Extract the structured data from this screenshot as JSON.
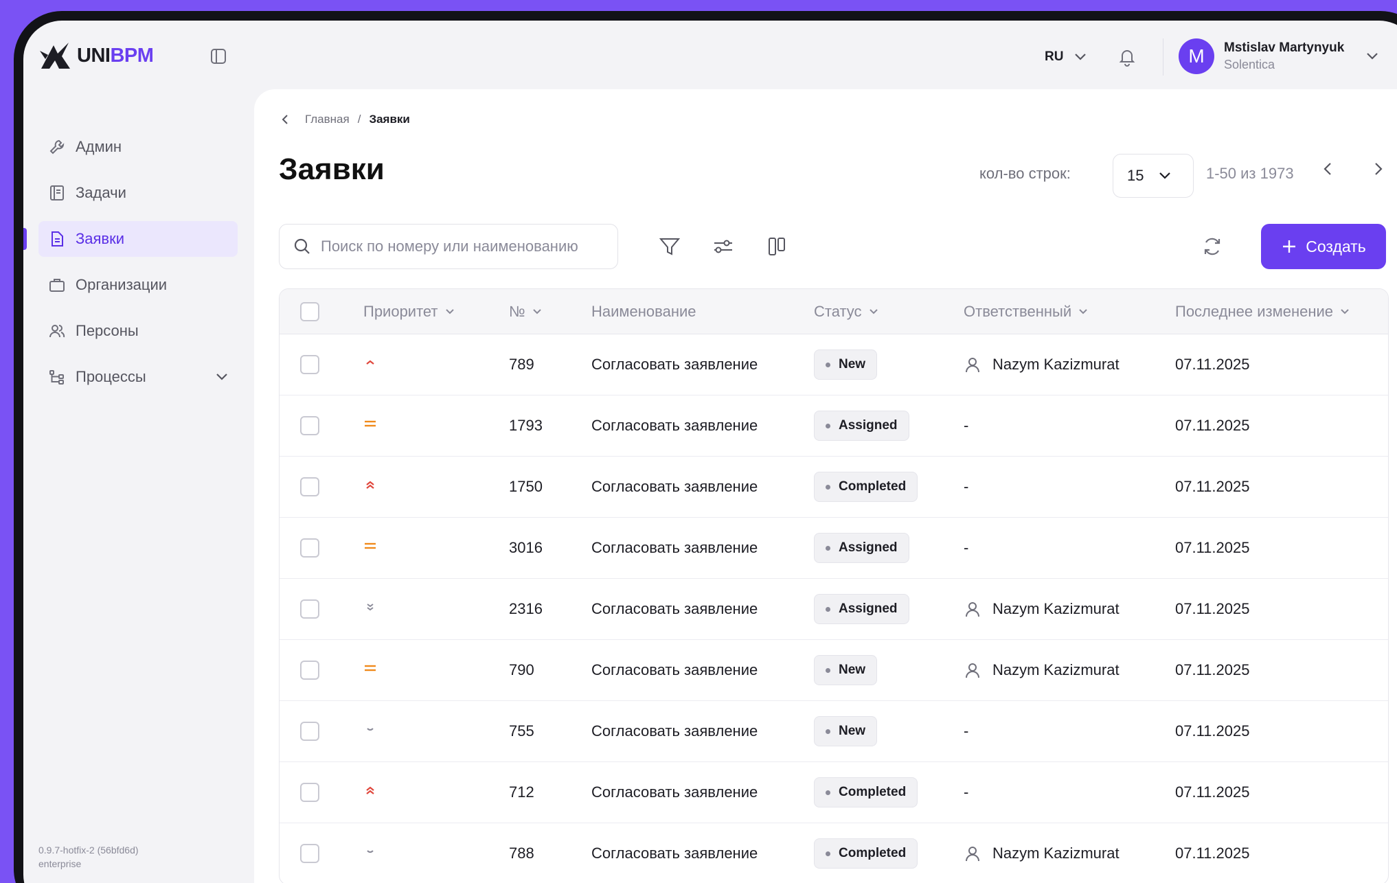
{
  "brand": {
    "logo_dark": "UNI",
    "logo_accent": "BPM"
  },
  "header": {
    "lang": "RU",
    "user_initial": "M",
    "user_name": "Mstislav Martynyuk",
    "user_org": "Solentica"
  },
  "sidebar": {
    "items": [
      {
        "label": "Админ",
        "icon": "wrench-icon"
      },
      {
        "label": "Задачи",
        "icon": "tasks-icon"
      },
      {
        "label": "Заявки",
        "icon": "document-icon",
        "active": true
      },
      {
        "label": "Организации",
        "icon": "briefcase-icon"
      },
      {
        "label": "Персоны",
        "icon": "users-icon"
      },
      {
        "label": "Процессы",
        "icon": "process-icon"
      }
    ],
    "version_line1": "0.9.7-hotfix-2 (56bfd6d)",
    "version_line2": "enterprise"
  },
  "breadcrumb": {
    "home": "Главная",
    "sep": "/",
    "current": "Заявки"
  },
  "page": {
    "title": "Заявки",
    "rows_label": "кол-во строк:",
    "rows_value": "15",
    "range": "1-50 из 1973",
    "search_placeholder": "Поиск по номеру или наименованию",
    "create_label": "Создать"
  },
  "table": {
    "headers": {
      "priority": "Приоритет",
      "number": "№",
      "name": "Наименование",
      "status": "Статус",
      "responsible": "Ответственный",
      "modified": "Последнее изменение"
    },
    "rows": [
      {
        "priority": "high",
        "number": "789",
        "name": "Согласовать заявление",
        "status": "New",
        "responsible": "Nazym Kazizmurat",
        "modified": "07.11.2025"
      },
      {
        "priority": "medium",
        "number": "1793",
        "name": "Согласовать заявление",
        "status": "Assigned",
        "responsible": "-",
        "modified": "07.11.2025"
      },
      {
        "priority": "highest",
        "number": "1750",
        "name": "Согласовать заявление",
        "status": "Completed",
        "responsible": "-",
        "modified": "07.11.2025"
      },
      {
        "priority": "medium",
        "number": "3016",
        "name": "Согласовать заявление",
        "status": "Assigned",
        "responsible": "-",
        "modified": "07.11.2025"
      },
      {
        "priority": "lowest",
        "number": "2316",
        "name": "Согласовать заявление",
        "status": "Assigned",
        "responsible": "Nazym Kazizmurat",
        "modified": "07.11.2025"
      },
      {
        "priority": "medium",
        "number": "790",
        "name": "Согласовать заявление",
        "status": "New",
        "responsible": "Nazym Kazizmurat",
        "modified": "07.11.2025"
      },
      {
        "priority": "low",
        "number": "755",
        "name": "Согласовать заявление",
        "status": "New",
        "responsible": "-",
        "modified": "07.11.2025"
      },
      {
        "priority": "highest",
        "number": "712",
        "name": "Согласовать заявление",
        "status": "Completed",
        "responsible": "-",
        "modified": "07.11.2025"
      },
      {
        "priority": "low",
        "number": "788",
        "name": "Согласовать заявление",
        "status": "Completed",
        "responsible": "Nazym Kazizmurat",
        "modified": "07.11.2025"
      }
    ]
  },
  "colors": {
    "accent": "#6a3ff0",
    "priority_high": "#e0473c",
    "priority_medium": "#f08a1c",
    "priority_low": "#8a8a98"
  }
}
